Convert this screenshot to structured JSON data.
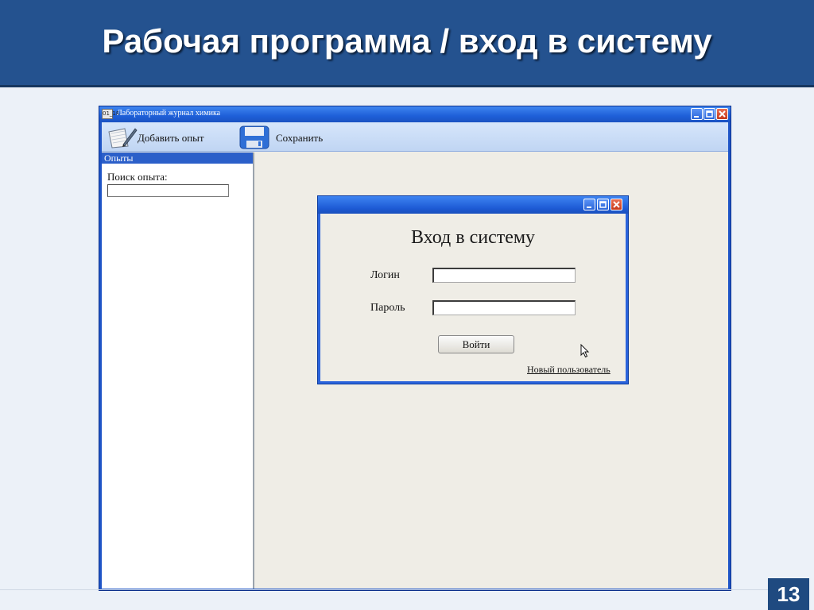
{
  "slide": {
    "title": "Рабочая программа / вход в систему",
    "page_number": "13"
  },
  "app": {
    "icon_text": "01_18",
    "title": "Лабораторный журнал химика",
    "toolbar": {
      "add_label": "Добавить опыт",
      "save_label": "Сохранить"
    },
    "sidebar": {
      "header": "Опыты",
      "search_label": "Поиск опыта:",
      "search_value": ""
    }
  },
  "login": {
    "heading": "Вход в систему",
    "login_label": "Логин",
    "login_value": "",
    "password_label": "Пароль",
    "password_value": "",
    "submit_label": "Войти",
    "new_user_label": "Новый пользователь"
  },
  "colors": {
    "slide_header": "#24528f",
    "window_frame": "#1f55c7",
    "window_body": "#efede6",
    "close_button": "#c6391b"
  },
  "icons": [
    "notebook-pencil-icon",
    "floppy-disk-icon",
    "minimize-icon",
    "maximize-icon",
    "close-icon",
    "mouse-pointer-icon"
  ]
}
